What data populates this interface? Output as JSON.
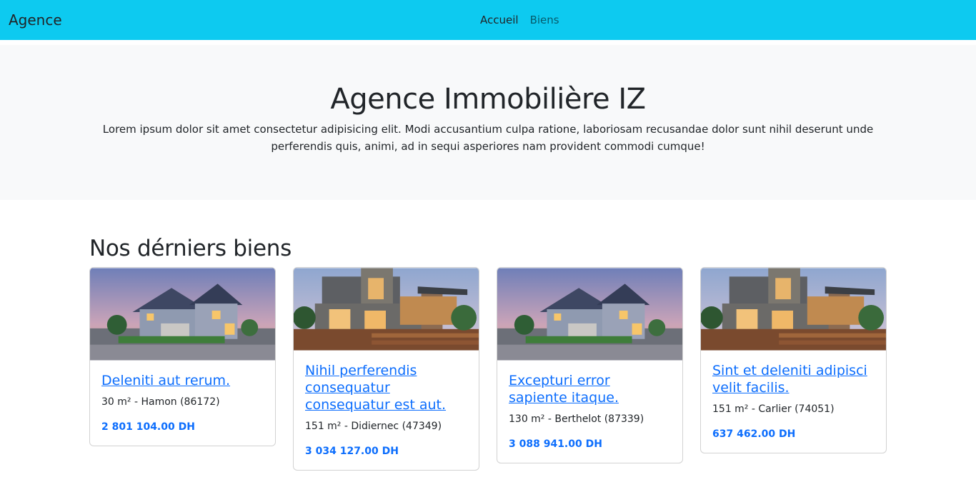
{
  "navbar": {
    "brand": "Agence",
    "links": [
      {
        "label": "Accueil"
      },
      {
        "label": "Biens"
      }
    ],
    "bg_color": "#0dcaf0"
  },
  "hero": {
    "title": "Agence Immobilière IZ",
    "text": "Lorem ipsum dolor sit amet consectetur adipisicing elit. Modi accusantium culpa ratione, laboriosam recusandae dolor sunt nihil deserunt unde perferendis quis, animi, ad in sequi asperiores nam provident commodi cumque!"
  },
  "section": {
    "title": "Nos dérniers biens"
  },
  "properties": [
    {
      "image": "house-craftsman-photo",
      "title": "Deleniti aut rerum.",
      "meta": "30 m² - Hamon (86172)",
      "price": "2 801 104.00 DH"
    },
    {
      "image": "house-modern-photo",
      "title": "Nihil perferendis consequatur consequatur est aut.",
      "meta": "151 m² - Didiernec (47349)",
      "price": "3 034 127.00 DH"
    },
    {
      "image": "house-craftsman-photo",
      "title": "Excepturi error sapiente itaque.",
      "meta": "130 m² - Berthelot (87339)",
      "price": "3 088 941.00 DH"
    },
    {
      "image": "house-modern-photo",
      "title": "Sint et deleniti adipisci velit facilis.",
      "meta": "151 m² - Carlier (74051)",
      "price": "637 462.00 DH"
    }
  ],
  "colors": {
    "link": "#0d6efd",
    "hero_bg": "#f8f9fa"
  }
}
